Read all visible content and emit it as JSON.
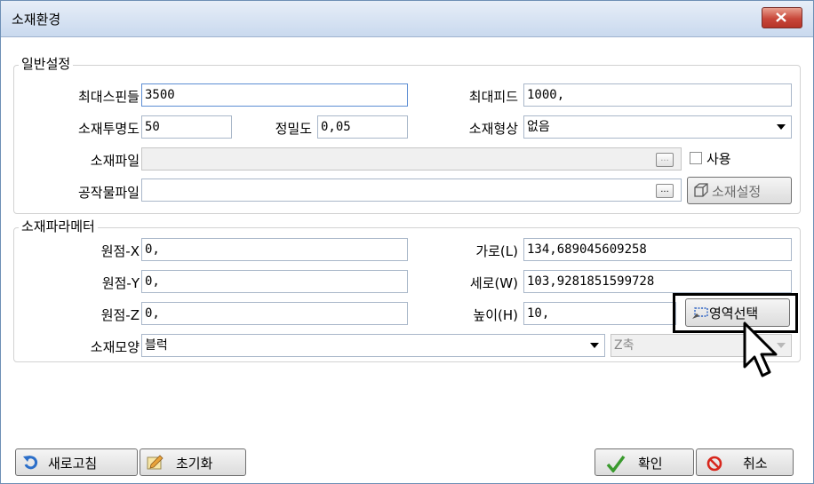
{
  "window": {
    "title": "소재환경"
  },
  "general": {
    "legend": "일반설정",
    "max_spindle_label": "최대스핀들",
    "max_spindle_value": "3500",
    "max_feed_label": "최대피드",
    "max_feed_value": "1000,",
    "transparency_label": "소재투명도",
    "transparency_value": "50",
    "precision_label": "정밀도",
    "precision_value": "0,05",
    "shape_label": "소재형상",
    "shape_value": "없음",
    "stock_file_label": "소재파일",
    "stock_file_value": "",
    "browse_glyph": "...",
    "use_label": "사용",
    "workpiece_file_label": "공작물파일",
    "workpiece_file_value": "",
    "stock_setup_label": "소재설정"
  },
  "params": {
    "legend": "소재파라메터",
    "origin_x_label": "원점-X",
    "origin_x_value": "0,",
    "origin_y_label": "원점-Y",
    "origin_y_value": "0,",
    "origin_z_label": "원점-Z",
    "origin_z_value": "0,",
    "width_label": "가로(L)",
    "width_value": "134,689045609258",
    "length_label": "세로(W)",
    "length_value": "103,9281851599728",
    "height_label": "높이(H)",
    "height_value": "10,",
    "region_select_label": "영역선택",
    "stock_type_label": "소재모양",
    "stock_type_value": "블럭",
    "axis_value": "Z축"
  },
  "footer": {
    "refresh_label": "새로고침",
    "reset_label": "초기화",
    "ok_label": "확인",
    "cancel_label": "취소"
  }
}
